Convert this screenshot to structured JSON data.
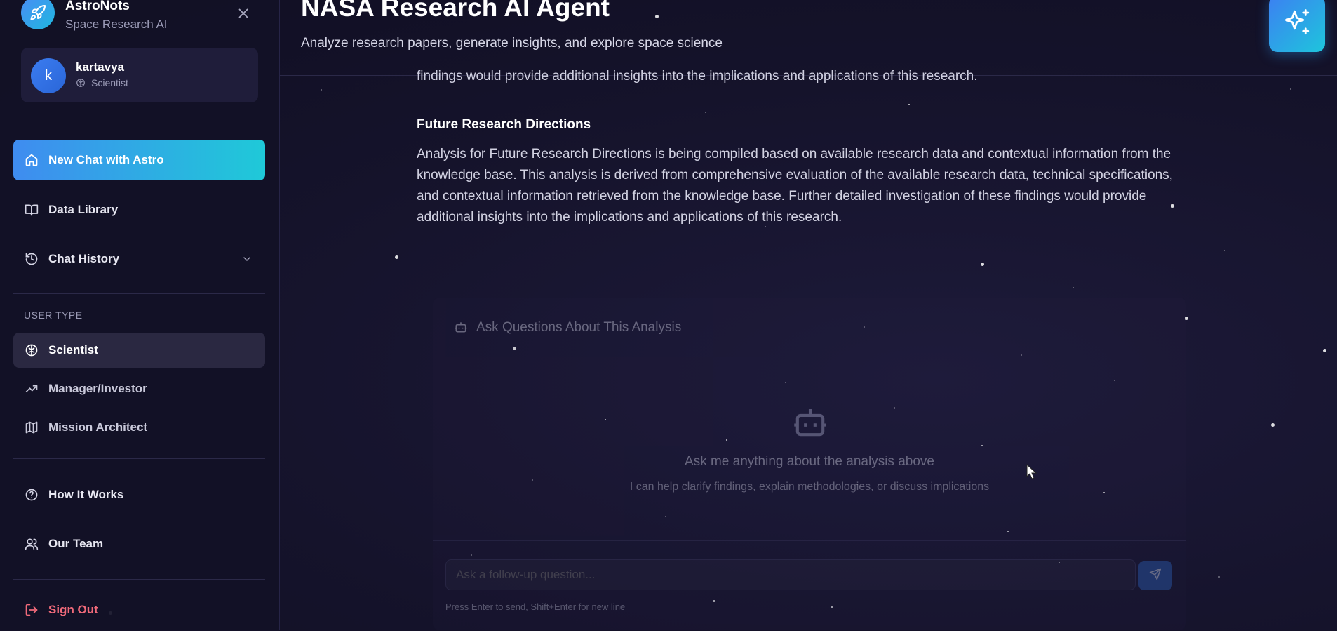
{
  "sidebar": {
    "brand_name": "AstroNots",
    "brand_sub": "Space Research AI",
    "user": {
      "initial": "k",
      "name": "kartavya",
      "role": "Scientist"
    },
    "nav_main": [
      {
        "label": "New Chat with Astro",
        "icon": "home-icon"
      },
      {
        "label": "Data Library",
        "icon": "book-icon"
      },
      {
        "label": "Chat History",
        "icon": "history-icon"
      }
    ],
    "user_type_label": "USER TYPE",
    "user_types": [
      {
        "label": "Scientist",
        "icon": "brain-icon",
        "active": true
      },
      {
        "label": "Manager/Investor",
        "icon": "trending-up-icon",
        "active": false
      },
      {
        "label": "Mission Architect",
        "icon": "map-icon",
        "active": false
      }
    ],
    "nav_secondary": [
      {
        "label": "How It Works",
        "icon": "help-circle-icon"
      },
      {
        "label": "Our Team",
        "icon": "users-icon"
      }
    ],
    "sign_out": "Sign Out"
  },
  "header": {
    "title": "NASA Research AI Agent",
    "subtitle": "Analyze research papers, generate insights, and explore space science"
  },
  "content": {
    "cut_line": "findings would provide additional insights into the implications and applications of this research.",
    "section_heading": "Future Research Directions",
    "section_body": "Analysis for Future Research Directions is being compiled based on available research data and contextual information from the knowledge base. This analysis is derived from comprehensive evaluation of the available research data, technical specifications, and contextual information retrieved from the knowledge base. Further detailed investigation of these findings would provide additional insights into the implications and applications of this research."
  },
  "chat": {
    "title": "Ask Questions About This Analysis",
    "empty_title": "Ask me anything about the analysis above",
    "empty_sub": "I can help clarify findings, explain methodologies, or discuss implications",
    "input_placeholder": "Ask a follow-up question...",
    "hint": "Press Enter to send, Shift+Enter for new line"
  },
  "colors": {
    "accent_start": "#3f8cf0",
    "accent_end": "#1fc9d8",
    "danger": "#f06a7a",
    "background": "#141228"
  }
}
